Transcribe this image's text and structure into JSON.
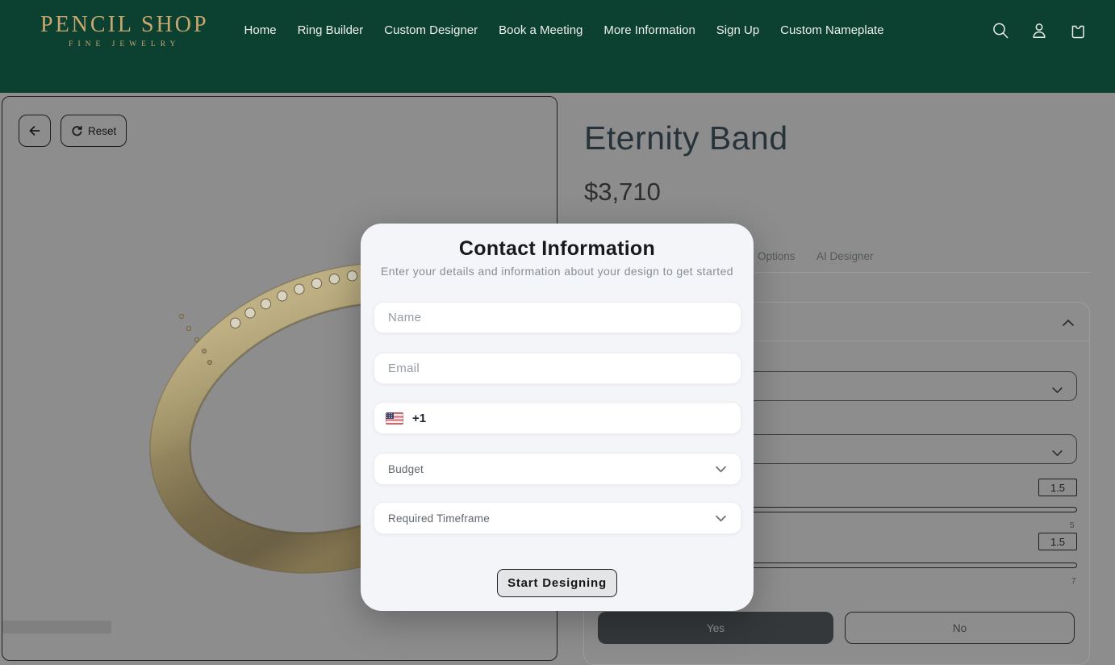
{
  "header": {
    "logo": {
      "title": "PENCIL SHOP",
      "subtitle": "FINE JEWELRY"
    },
    "nav": [
      "Home",
      "Ring Builder",
      "Custom Designer",
      "Book a Meeting",
      "More Information",
      "Sign Up",
      "Custom Nameplate"
    ]
  },
  "viewer": {
    "reset_label": "Reset"
  },
  "product": {
    "title": "Eternity Band",
    "price": "$3,710",
    "tabs": [
      "Options",
      "AI Designer"
    ],
    "options_panel": {
      "sliders": [
        {
          "value": "1.5",
          "max_label": "5"
        },
        {
          "value": "1.5",
          "max_label": "7"
        }
      ],
      "yes_label": "Yes",
      "no_label": "No"
    }
  },
  "modal": {
    "title": "Contact Information",
    "subtitle": "Enter your details and information about your design to get started",
    "name_placeholder": "Name",
    "email_placeholder": "Email",
    "phone_code": "+1",
    "budget_label": "Budget",
    "timeframe_label": "Required Timeframe",
    "submit_label": "Start Designing"
  },
  "colors": {
    "header_bg": "#0c4132",
    "logo_gold": "#c8a86e",
    "dimmed_page": "#8d8d8d",
    "modal_bg": "#f4f5f8",
    "ring_gold": "#8d8059"
  }
}
